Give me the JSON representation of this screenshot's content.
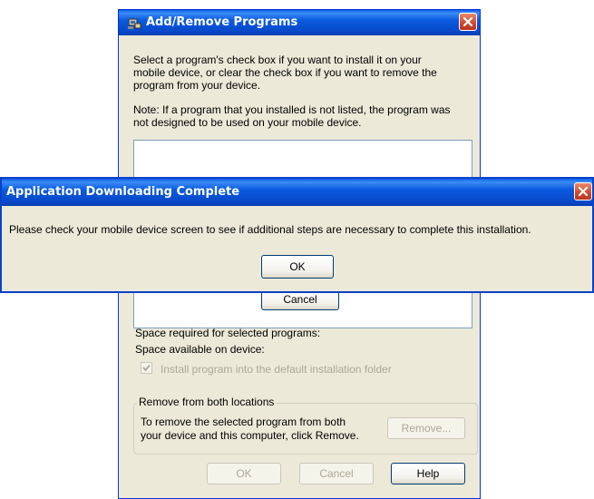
{
  "back_window": {
    "title": "Add/Remove Programs",
    "instructions_lines": [
      "Select a program's check box if you want to install it on your",
      "mobile device, or clear the check box if you want to remove the",
      "program from your device."
    ],
    "note_lines": [
      "Note:  If a program that you installed is not listed, the program was",
      "not designed to be used on your mobile device."
    ],
    "cancel_label": "Cancel",
    "space_required_label": "Space required for selected programs:",
    "space_available_label": "Space available on device:",
    "install_default_folder_label": "Install program into the default installation folder",
    "remove_group": {
      "legend": "Remove from both locations",
      "text_lines": [
        "To remove the selected program from both",
        "your device and this computer, click Remove."
      ],
      "remove_label": "Remove..."
    },
    "ok_label": "OK",
    "cancel2_label": "Cancel",
    "help_label": "Help"
  },
  "dialog": {
    "title": "Application Downloading Complete",
    "message": "Please check your mobile device screen to see if additional steps are necessary to complete this installation.",
    "ok_label": "OK"
  },
  "icons": {
    "back_window_icon": "programs-icon",
    "close": "close-icon"
  }
}
